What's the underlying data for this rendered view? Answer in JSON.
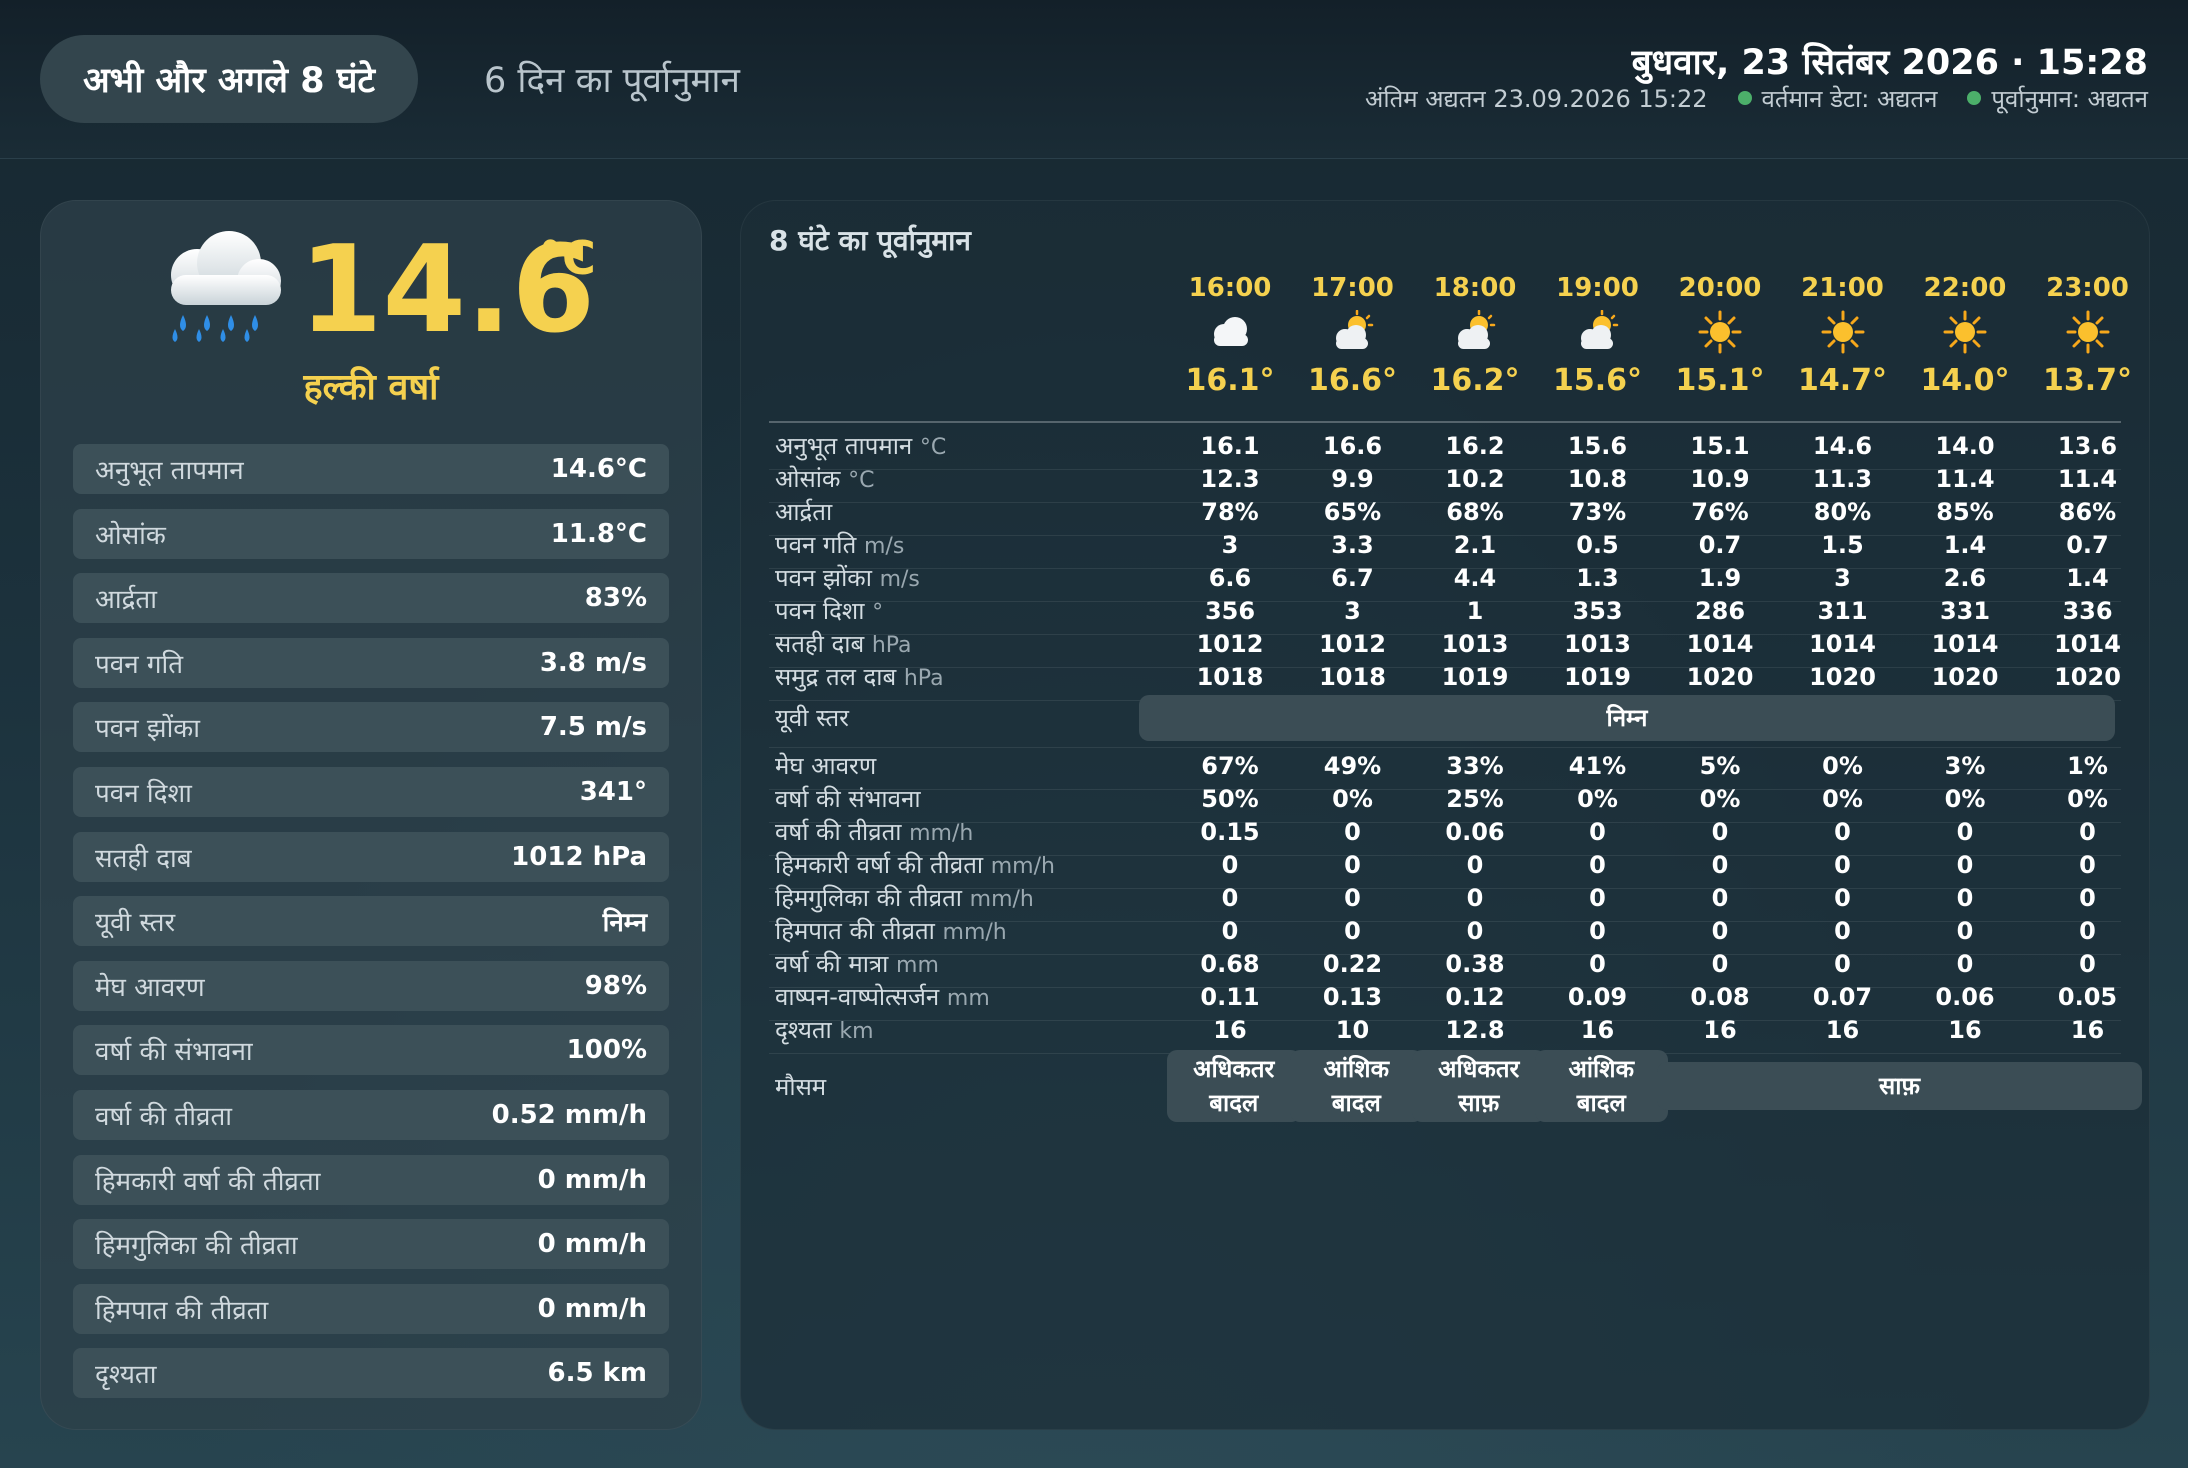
{
  "header": {
    "tab_now": "अभी और अगले 8 घंटे",
    "tab_forecast": "6 दिन का पूर्वानुमान",
    "date_time": "बुधवार, 23 सितंबर 2026 · 15:28",
    "last_update": "अंतिम अद्यतन 23.09.2026 15:22",
    "status_current": "वर्तमान डेटा: अद्यतन",
    "status_forecast": "पूर्वानुमान: अद्यतन",
    "status_color": "#4caf6a"
  },
  "current": {
    "icon": "rain-cloud-icon",
    "temp": "14.6",
    "unit": "°C",
    "desc": "हल्की वर्षा",
    "rows": [
      {
        "label": "अनुभूत तापमान",
        "value": "14.6°C"
      },
      {
        "label": "ओसांक",
        "value": "11.8°C"
      },
      {
        "label": "आर्द्रता",
        "value": "83%"
      },
      {
        "label": "पवन गति",
        "value": "3.8 m/s"
      },
      {
        "label": "पवन झोंका",
        "value": "7.5 m/s"
      },
      {
        "label": "पवन दिशा",
        "value": "341°"
      },
      {
        "label": "सतही दाब",
        "value": "1012 hPa"
      },
      {
        "label": "यूवी स्तर",
        "value": "निम्न"
      },
      {
        "label": "मेघ आवरण",
        "value": "98%"
      },
      {
        "label": "वर्षा की संभावना",
        "value": "100%"
      },
      {
        "label": "वर्षा की तीव्रता",
        "value": "0.52 mm/h"
      },
      {
        "label": "हिमकारी वर्षा की तीव्रता",
        "value": "0 mm/h"
      },
      {
        "label": "हिमगुलिका की तीव्रता",
        "value": "0 mm/h"
      },
      {
        "label": "हिमपात की तीव्रता",
        "value": "0 mm/h"
      },
      {
        "label": "दृश्यता",
        "value": "6.5 km"
      }
    ]
  },
  "forecast": {
    "title": "8 घंटे का पूर्वानुमान",
    "hours": [
      {
        "time": "16:00",
        "icon": "cloud-icon",
        "temp": "16.1°"
      },
      {
        "time": "17:00",
        "icon": "sun-behind-cloud-icon",
        "temp": "16.6°"
      },
      {
        "time": "18:00",
        "icon": "sun-behind-cloud-icon",
        "temp": "16.2°"
      },
      {
        "time": "19:00",
        "icon": "sun-behind-cloud-icon",
        "temp": "15.6°"
      },
      {
        "time": "20:00",
        "icon": "sun-icon",
        "temp": "15.1°"
      },
      {
        "time": "21:00",
        "icon": "sun-icon",
        "temp": "14.7°"
      },
      {
        "time": "22:00",
        "icon": "sun-icon",
        "temp": "14.0°"
      },
      {
        "time": "23:00",
        "icon": "sun-icon",
        "temp": "13.7°"
      }
    ],
    "rows_a": [
      {
        "label": "अनुभूत तापमान",
        "unit": "°C",
        "values": [
          "16.1",
          "16.6",
          "16.2",
          "15.6",
          "15.1",
          "14.6",
          "14.0",
          "13.6"
        ]
      },
      {
        "label": "ओसांक",
        "unit": "°C",
        "values": [
          "12.3",
          "9.9",
          "10.2",
          "10.8",
          "10.9",
          "11.3",
          "11.4",
          "11.4"
        ]
      },
      {
        "label": "आर्द्रता",
        "unit": "",
        "values": [
          "78%",
          "65%",
          "68%",
          "73%",
          "76%",
          "80%",
          "85%",
          "86%"
        ]
      },
      {
        "label": "पवन गति",
        "unit": "m/s",
        "values": [
          "3",
          "3.3",
          "2.1",
          "0.5",
          "0.7",
          "1.5",
          "1.4",
          "0.7"
        ]
      },
      {
        "label": "पवन झोंका",
        "unit": "m/s",
        "values": [
          "6.6",
          "6.7",
          "4.4",
          "1.3",
          "1.9",
          "3",
          "2.6",
          "1.4"
        ]
      },
      {
        "label": "पवन दिशा",
        "unit": "°",
        "values": [
          "356",
          "3",
          "1",
          "353",
          "286",
          "311",
          "331",
          "336"
        ]
      },
      {
        "label": "सतही दाब",
        "unit": "hPa",
        "values": [
          "1012",
          "1012",
          "1013",
          "1013",
          "1014",
          "1014",
          "1014",
          "1014"
        ]
      },
      {
        "label": "समुद्र तल दाब",
        "unit": "hPa",
        "values": [
          "1018",
          "1018",
          "1019",
          "1019",
          "1020",
          "1020",
          "1020",
          "1020"
        ]
      }
    ],
    "uv": {
      "label": "यूवी स्तर",
      "value": "निम्न"
    },
    "rows_b": [
      {
        "label": "मेघ आवरण",
        "unit": "",
        "values": [
          "67%",
          "49%",
          "33%",
          "41%",
          "5%",
          "0%",
          "3%",
          "1%"
        ]
      },
      {
        "label": "वर्षा की संभावना",
        "unit": "",
        "values": [
          "50%",
          "0%",
          "25%",
          "0%",
          "0%",
          "0%",
          "0%",
          "0%"
        ]
      },
      {
        "label": "वर्षा की तीव्रता",
        "unit": "mm/h",
        "values": [
          "0.15",
          "0",
          "0.06",
          "0",
          "0",
          "0",
          "0",
          "0"
        ]
      },
      {
        "label": "हिमकारी वर्षा की तीव्रता",
        "unit": "mm/h",
        "values": [
          "0",
          "0",
          "0",
          "0",
          "0",
          "0",
          "0",
          "0"
        ]
      },
      {
        "label": "हिमगुलिका की तीव्रता",
        "unit": "mm/h",
        "values": [
          "0",
          "0",
          "0",
          "0",
          "0",
          "0",
          "0",
          "0"
        ]
      },
      {
        "label": "हिमपात की तीव्रता",
        "unit": "mm/h",
        "values": [
          "0",
          "0",
          "0",
          "0",
          "0",
          "0",
          "0",
          "0"
        ]
      },
      {
        "label": "वर्षा की मात्रा",
        "unit": "mm",
        "values": [
          "0.68",
          "0.22",
          "0.38",
          "0",
          "0",
          "0",
          "0",
          "0"
        ]
      },
      {
        "label": "वाष्पन-वाष्पोत्सर्जन",
        "unit": "mm",
        "values": [
          "0.11",
          "0.13",
          "0.12",
          "0.09",
          "0.08",
          "0.07",
          "0.06",
          "0.05"
        ]
      },
      {
        "label": "दृश्यता",
        "unit": "km",
        "values": [
          "16",
          "10",
          "12.8",
          "16",
          "16",
          "16",
          "16",
          "16"
        ]
      }
    ],
    "weather": {
      "label": "मौसम",
      "boxes": [
        {
          "text": "अधिकतर बादल",
          "span": 1
        },
        {
          "text": "आंशिक बादल",
          "span": 1
        },
        {
          "text": "अधिकतर साफ़",
          "span": 1
        },
        {
          "text": "आंशिक बादल",
          "span": 1
        },
        {
          "text": "साफ़",
          "span": 4
        }
      ]
    }
  },
  "colors": {
    "accent": "#f5d14f",
    "panel": "#2e404a",
    "row": "#3c5058"
  }
}
